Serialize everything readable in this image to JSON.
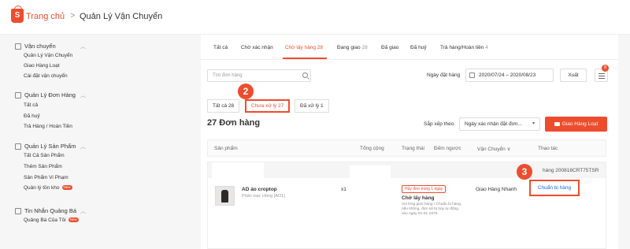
{
  "header": {
    "brand_label": "Trang chủ",
    "separator": ">",
    "current_page": "Quản Lý Vận Chuyển",
    "brand_color": "#ee4d2d"
  },
  "sidebar": {
    "groups": [
      {
        "title": "Vận chuyển",
        "icon": "truck-icon",
        "items": [
          "Quản Lý Vận Chuyển",
          "Giao Hàng Loạt",
          "Cài đặt vận chuyển"
        ]
      },
      {
        "title": "Quản Lý Đơn Hàng",
        "icon": "clipboard-icon",
        "items": [
          "Tất cả",
          "Đã huỷ",
          "Trả Hàng / Hoàn Tiền"
        ]
      },
      {
        "title": "Quản Lý Sản Phẩm",
        "icon": "box-icon",
        "items": [
          "Tất Cả Sản Phẩm",
          "Thêm Sản Phẩm",
          "Sản Phẩm Vi Phạm",
          "Quản lý tồn kho"
        ],
        "badges": {
          "3": "New"
        }
      },
      {
        "title": "Tin Nhắn Quảng Bá",
        "icon": "megaphone-icon",
        "items": [
          "Quảng Bá Của Tôi"
        ],
        "badges": {
          "0": "New"
        }
      }
    ]
  },
  "tabs": [
    {
      "label": "Tất cả",
      "count": ""
    },
    {
      "label": "Chờ xác nhận",
      "count": ""
    },
    {
      "label": "Chờ lấy hàng",
      "count": "28"
    },
    {
      "label": "Đang giao",
      "count": "28"
    },
    {
      "label": "Đã giao",
      "count": ""
    },
    {
      "label": "Đã huỷ",
      "count": ""
    },
    {
      "label": "Trả hàng/Hoàn tiền",
      "count": "4"
    }
  ],
  "filters": {
    "search_placeholder": "Tìm đơn hàng",
    "date_label": "Ngày đặt hàng",
    "date_range": "2020/07/24 – 2020/08/23",
    "export_label": "Xuất",
    "list_badge": "8"
  },
  "subtabs": [
    "Tất cả 28",
    "Chưa xử lý 27",
    "Đã xử lý 1"
  ],
  "callouts": [
    "2",
    "3"
  ],
  "orders": {
    "count_title": "27 Đơn hàng",
    "sort_label": "Sắp xếp theo",
    "sort_value": "Ngày xác nhận đặt đơn...",
    "bulk_ship_label": "Giao Hàng Loạt"
  },
  "table": {
    "columns": [
      "Sản phẩm",
      "Tổng cộng",
      "Trạng thái",
      "Đếm ngược",
      "Vận Chuyển ∨",
      "Thao tác"
    ],
    "order_code": "hàng 200818CRT75TSR",
    "row": {
      "product_name": "AD áo croptop",
      "variant": "Phân loại: Hồng [AO1]",
      "quantity": "x1",
      "cancel_badge": "Hủy đơn trong 1 ngày",
      "status": "Chờ lấy hàng",
      "status_note": "Vui lòng giao hàng / Chuẩn bị hàng, nếu không, đơn sẽ bị hủy tự động vào ngày 01-01-1970.",
      "carrier": "Giao Hàng Nhanh",
      "action": "Chuẩn bị hàng"
    }
  }
}
